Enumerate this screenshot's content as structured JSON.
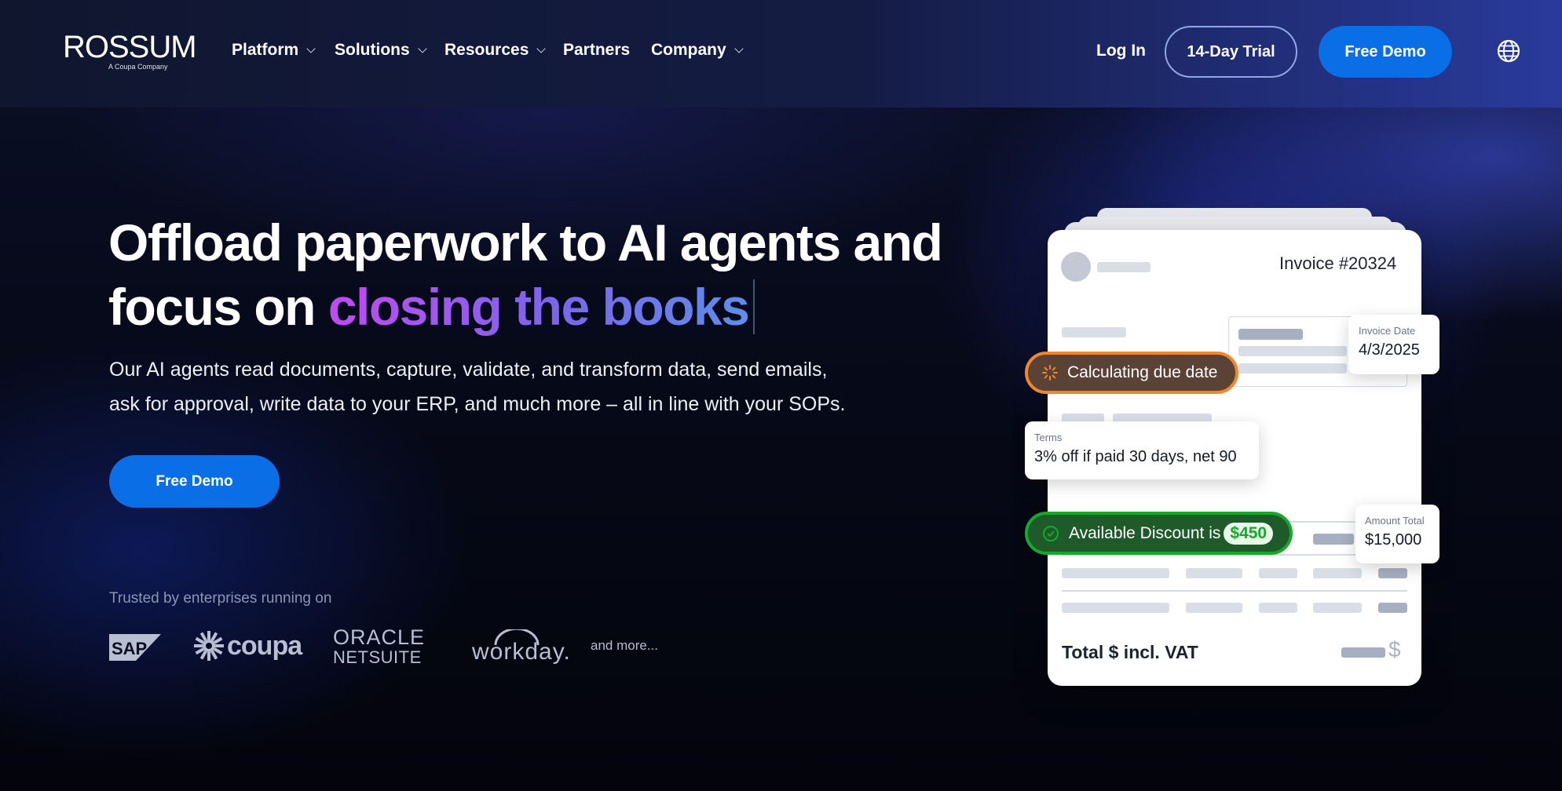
{
  "nav": {
    "logo": "ROSSUM",
    "logo_sub": "A Coupa Company",
    "items": [
      {
        "label": "Platform",
        "dropdown": true
      },
      {
        "label": "Solutions",
        "dropdown": true
      },
      {
        "label": "Resources",
        "dropdown": true
      },
      {
        "label": "Partners",
        "dropdown": false
      },
      {
        "label": "Company",
        "dropdown": true
      }
    ],
    "login": "Log In",
    "trial": "14-Day Trial",
    "demo": "Free Demo",
    "globe_icon": "globe-icon"
  },
  "hero": {
    "headline_1": "Offload paperwork to AI agents and",
    "headline_2a": "focus on ",
    "headline_2b": "closing the books",
    "subtext_1": "Our AI agents read documents, capture, validate, and transform data, send emails,",
    "subtext_2": "ask for approval, write data to your ERP, and much more – all in line with your SOPs.",
    "cta": "Free Demo",
    "trusted": "Trusted by enterprises running on",
    "partners": [
      {
        "name": "SAP"
      },
      {
        "name": "coupa"
      },
      {
        "name": "ORACLE",
        "sub": "NETSUITE"
      },
      {
        "name": "workday."
      }
    ],
    "and_more": "and more..."
  },
  "invoice": {
    "title": "Invoice #20324",
    "invoice_date_label": "Invoice Date",
    "invoice_date": "4/3/2025",
    "calculating": "Calculating due date",
    "terms_label": "Terms",
    "terms": "3% off if paid 30 days, net 90",
    "discount_label": "Available Discount is",
    "discount_amount": "$450",
    "amount_total_label": "Amount Total",
    "amount_total": "$15,000",
    "total_label": "Total $ incl. VAT",
    "currency_symbol": "$"
  },
  "colors": {
    "primary": "#0a6ee6",
    "calc_orange": "#f0862e",
    "discount_green": "#17a82b"
  }
}
